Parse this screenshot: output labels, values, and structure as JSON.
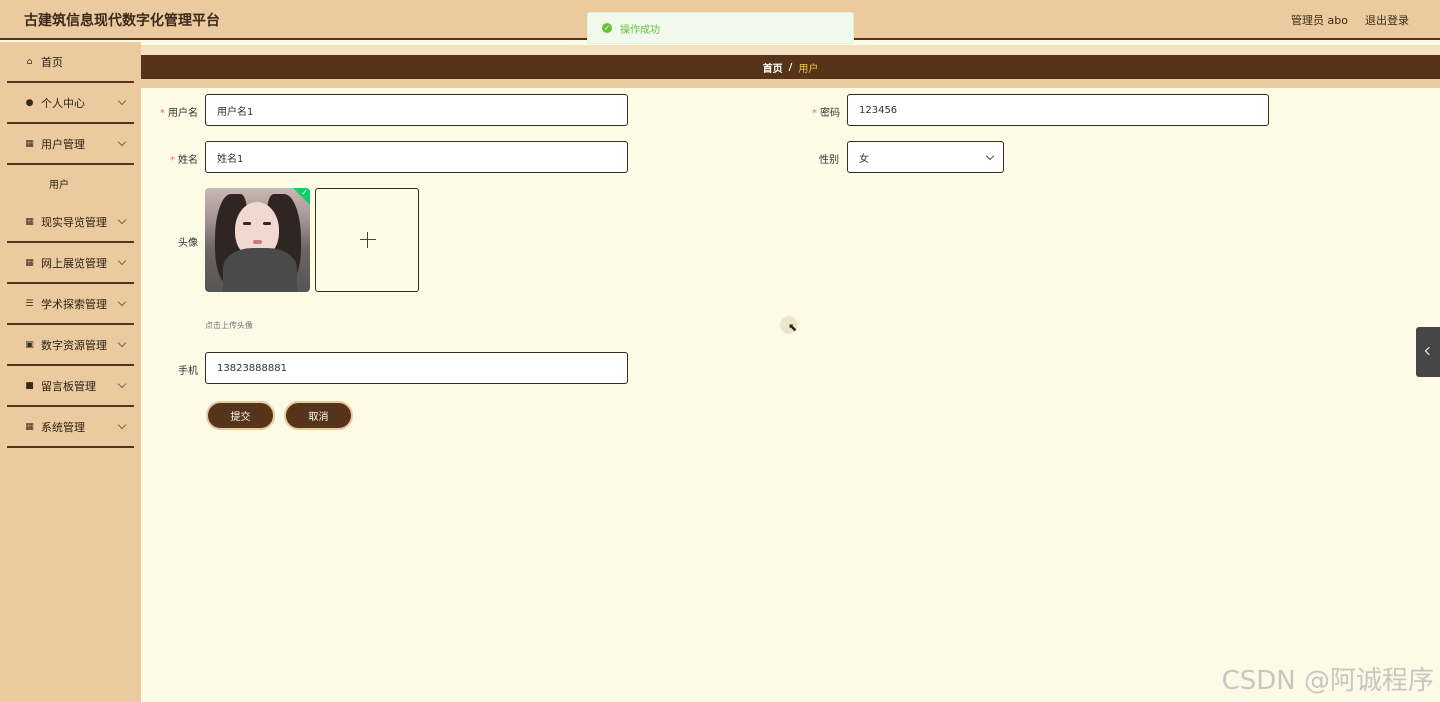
{
  "app": {
    "title": "古建筑信息现代数字化管理平台"
  },
  "header": {
    "user": "管理员 abo",
    "logout": "退出登录"
  },
  "toast": {
    "message": "操作成功"
  },
  "sidebar": {
    "items": [
      {
        "label": "首页",
        "icon": "home-icon"
      },
      {
        "label": "个人中心",
        "icon": "user-icon"
      },
      {
        "label": "用户管理",
        "icon": "grid-icon",
        "sub": [
          "用户"
        ]
      },
      {
        "label": "现实导览管理",
        "icon": "grid-icon"
      },
      {
        "label": "网上展览管理",
        "icon": "grid-icon"
      },
      {
        "label": "学术探索管理",
        "icon": "sliders-icon"
      },
      {
        "label": "数字资源管理",
        "icon": "clipboard-icon"
      },
      {
        "label": "留言板管理",
        "icon": "book-icon"
      },
      {
        "label": "系统管理",
        "icon": "grid-icon"
      }
    ]
  },
  "breadcrumb": {
    "home": "首页",
    "sep": "/",
    "current": "用户"
  },
  "form": {
    "username": {
      "label": "用户名",
      "value": "用户名1"
    },
    "password": {
      "label": "密码",
      "value": "123456"
    },
    "name": {
      "label": "姓名",
      "value": "姓名1"
    },
    "gender": {
      "label": "性别",
      "value": "女"
    },
    "avatar": {
      "label": "头像",
      "tip": "点击上传头像"
    },
    "phone": {
      "label": "手机",
      "value": "13823888881"
    },
    "submit": "提交",
    "cancel": "取消"
  },
  "watermark": "CSDN @阿诚程序"
}
